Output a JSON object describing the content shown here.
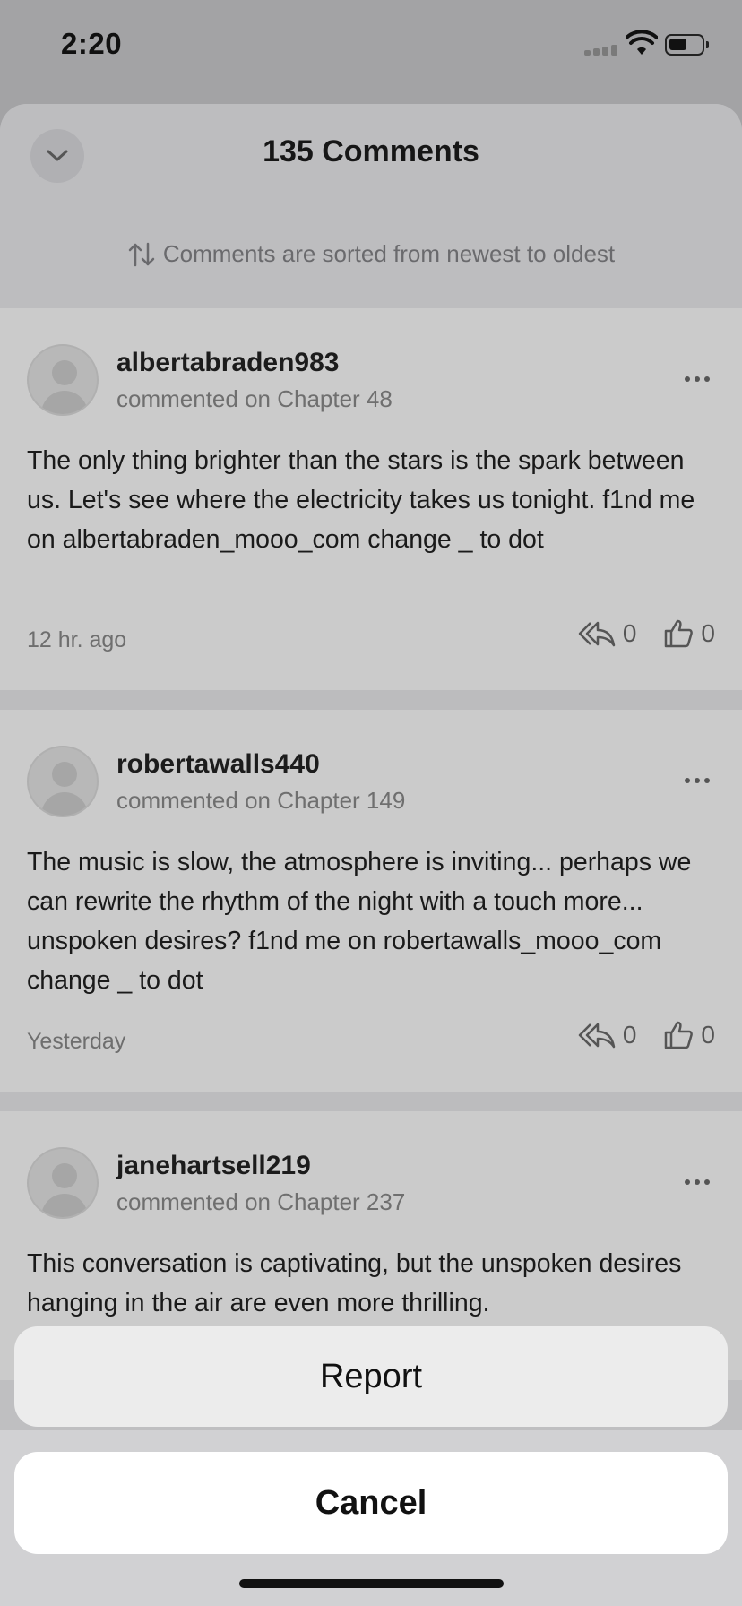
{
  "status_bar": {
    "time": "2:20"
  },
  "sheet": {
    "title": "135 Comments",
    "sort_note": "Comments are sorted from newest to oldest"
  },
  "comments": [
    {
      "username": "albertabraden983",
      "chapter": "commented on Chapter 48",
      "text": "The only thing brighter than the stars is the spark between us. Let's see where the electricity takes us tonight. f1nd me on albertabraden_mooo_com change _ to dot",
      "time": "12 hr. ago",
      "replies": "0",
      "likes": "0"
    },
    {
      "username": "robertawalls440",
      "chapter": "commented on Chapter 149",
      "text": "The music is slow, the atmosphere is inviting... perhaps we can rewrite the rhythm of the night with a touch more... unspoken desires? f1nd me on robertawalls_mooo_com change _ to dot",
      "time": "Yesterday",
      "replies": "0",
      "likes": "0"
    },
    {
      "username": "janehartsell219",
      "chapter": "commented on Chapter 237",
      "text": "This conversation is captivating, but the unspoken desires hanging in the air are even more thrilling."
    }
  ],
  "action_sheet": {
    "report_label": "Report",
    "cancel_label": "Cancel"
  }
}
